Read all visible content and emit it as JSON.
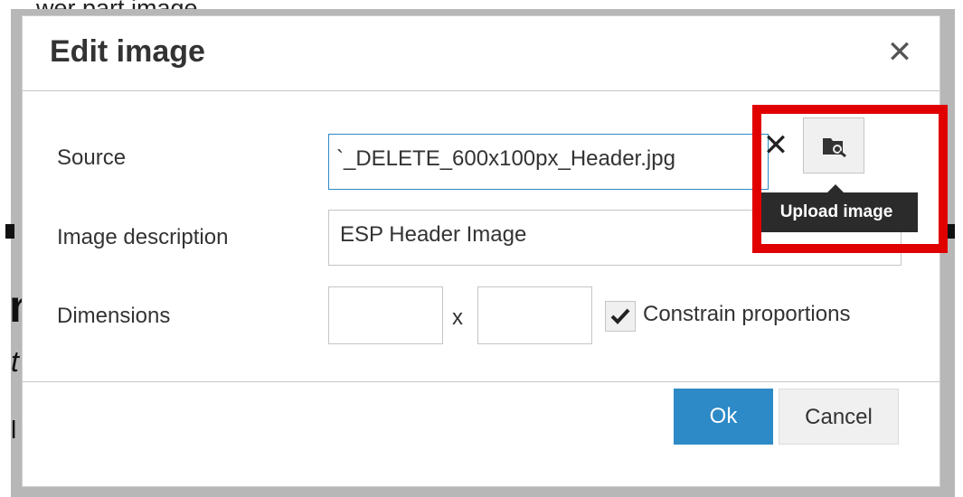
{
  "top_fragment": "wer part image.",
  "dialog": {
    "title": "Edit image",
    "close_glyph": "✕",
    "source": {
      "label": "Source",
      "value": "`_DELETE_600x100px_Header.jpg",
      "clear_glyph": "✕",
      "browse_icon": "browse-folder-icon",
      "tooltip": "Upload image"
    },
    "description": {
      "label": "Image description",
      "value": "ESP Header Image"
    },
    "dimensions": {
      "label": "Dimensions",
      "width_value": "",
      "height_value": "",
      "separator": "x",
      "constrain_label": "Constrain proportions",
      "constrain_checked": true
    },
    "footer": {
      "ok_label": "Ok",
      "cancel_label": "Cancel"
    }
  },
  "colors": {
    "primary": "#2d8ac7",
    "highlight": "#e00000",
    "tooltip_bg": "#2b2b2b"
  }
}
